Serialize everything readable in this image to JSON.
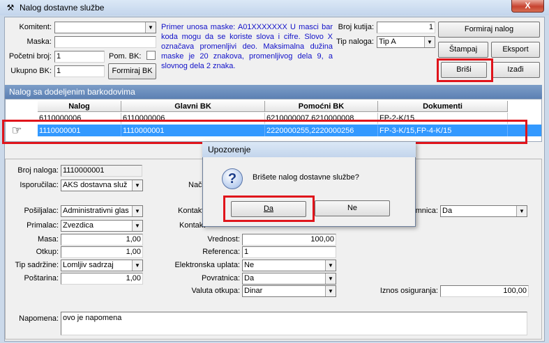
{
  "window": {
    "title": "Nalog dostavne službe",
    "close_label": "X"
  },
  "top_form": {
    "komitent_label": "Komitent:",
    "komitent_value": "",
    "maska_label": "Maska:",
    "maska_value": "",
    "pocetni_broj_label": "Početni broj:",
    "pocetni_broj_value": "1",
    "pom_bk_label": "Pom. BK:",
    "ukupno_bk_label": "Ukupno BK:",
    "ukupno_bk_value": "1",
    "formiraj_bk_label": "Formiraj BK",
    "hint": "Primer unosa maske: A01XXXXXXX U masci bar koda mogu da se koriste slova i cifre. Slovo X označava promenljivi deo. Maksimalna dužina maske je 20 znakova, promenljivog dela 9, a slovnog dela 2 znaka.",
    "broj_kutija_label": "Broj kutija:",
    "broj_kutija_value": "1",
    "tip_naloga_label": "Tip naloga:",
    "tip_naloga_value": "Tip A"
  },
  "buttons": {
    "formiraj_nalog": "Formiraj nalog",
    "stampaj": "Štampaj",
    "eksport": "Eksport",
    "brisi": "Briši",
    "izadi": "Izađi"
  },
  "grid": {
    "title": "Nalog sa dodeljenim barkodovima",
    "columns": [
      "Nalog",
      "Glavni BK",
      "Pomoćni BK",
      "Dokumenti"
    ],
    "rows": [
      [
        "6110000006",
        "6110000006",
        "6210000007,6210000008",
        "FP-2-K/15"
      ],
      [
        "1110000001",
        "1110000001",
        "2220000255,2220000256",
        "FP-3-K/15,FP-4-K/15"
      ]
    ]
  },
  "detail": {
    "broj_naloga_label": "Broj naloga:",
    "broj_naloga_value": "1110000001",
    "isporucilac_label": "Isporučilac:",
    "isporucilac_value": "AKS dostavna služ",
    "na_label": "Nač",
    "posiljalac_label": "Pošiljalac:",
    "posiljalac_value": "Administrativni glas",
    "kontakt1_label": "Kontakt",
    "primalac_label": "Primalac:",
    "primalac_value": "Zvezdica",
    "kontakt2_label": "Kontakt",
    "masa_label": "Masa:",
    "masa_value": "1,00",
    "otkup_label": "Otkup:",
    "otkup_value": "1,00",
    "tip_sadrzine_label": "Tip sadržine:",
    "tip_sadrzine_value": "Lomljiv sadrzaj",
    "postarina_label": "Poštarina:",
    "postarina_value": "1,00",
    "vrednost_label": "Vrednost:",
    "vrednost_value": "100,00",
    "referenca_label": "Referenca:",
    "referenca_value": "1",
    "elektronska_label": "Elektronska uplata:",
    "elektronska_value": "Ne",
    "povratnica_label": "Povratnica:",
    "povratnica_value": "Da",
    "valuta_label": "Valuta otkupa:",
    "valuta_value": "Dinar",
    "emnica_label": "emnica:",
    "emnica_value": "Da",
    "iznos_label": "Iznos osiguranja:",
    "iznos_value": "100,00",
    "napomena_label": "Napomena:",
    "napomena_value": "ovo je napomena"
  },
  "dialog": {
    "title": "Upozorenje",
    "message": "Brišete nalog dostavne službe?",
    "yes": "Da",
    "no": "Ne",
    "icon": "question-icon"
  },
  "colors": {
    "selection": "#3399ff",
    "highlight": "#e0141b",
    "hint_text": "#1010c8"
  }
}
